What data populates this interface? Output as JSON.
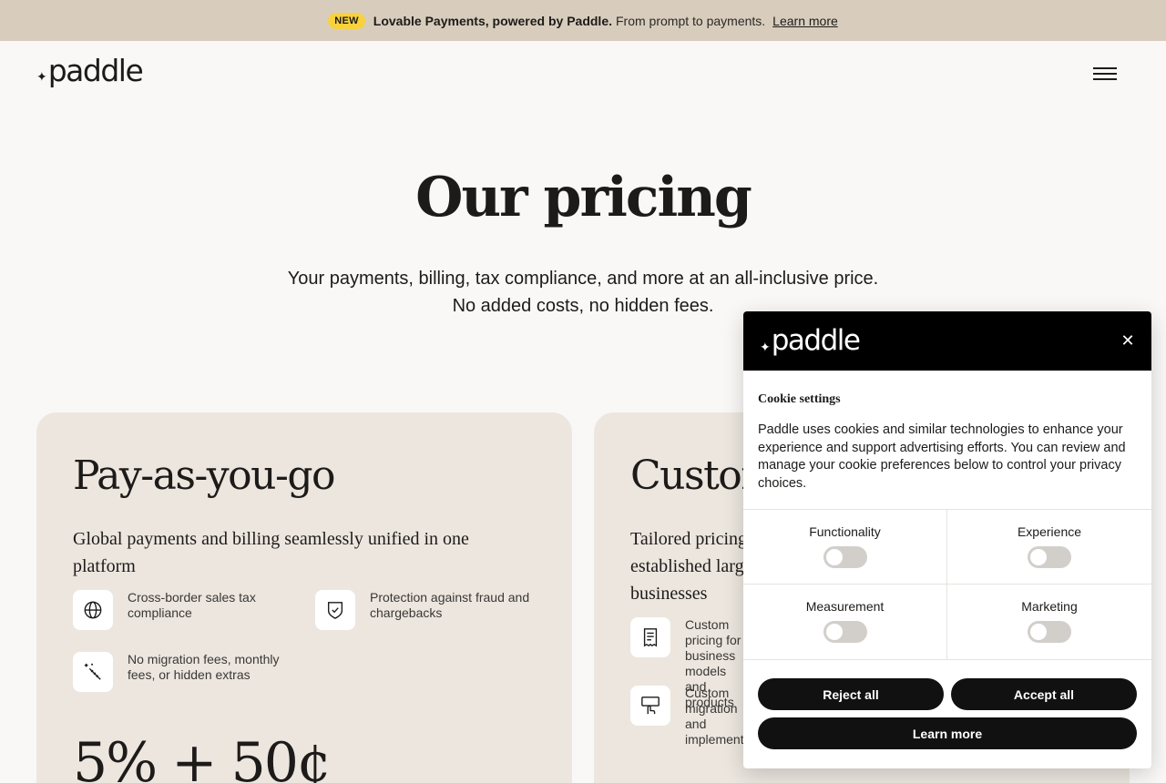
{
  "banner": {
    "badge": "NEW",
    "strong": "Lovable Payments, powered by Paddle.",
    "rest": "From prompt to payments.",
    "link": "Learn more"
  },
  "header": {
    "logo": "paddle",
    "menu_icon": "hamburger-menu-icon"
  },
  "hero": {
    "title": "Our pricing",
    "subtitle_line1": "Your payments, billing, tax compliance, and more at an all-inclusive price.",
    "subtitle_line2": "No added costs, no hidden fees."
  },
  "plans": [
    {
      "title": "Pay-as-you-go",
      "description": "Global payments and billing seamlessly unified in one platform",
      "features": [
        {
          "icon": "globe-icon",
          "text": "Cross-border sales tax compliance"
        },
        {
          "icon": "shield-check-icon",
          "text": "Protection against fraud and chargebacks"
        },
        {
          "icon": "magic-wand-icon",
          "text": "No migration fees, monthly fees, or hidden extras"
        }
      ],
      "price": "5% + 50¢"
    },
    {
      "title": "Custom",
      "description": "Tailored pricing for established large businesses",
      "features": [
        {
          "icon": "receipt-icon",
          "text": "Custom pricing for business models and products"
        },
        {
          "icon": "hand-pointer-icon",
          "text": "Custom migration and implementation"
        }
      ]
    }
  ],
  "cookie": {
    "logo": "paddle",
    "close_icon": "close-icon",
    "title": "Cookie settings",
    "body": "Paddle uses cookies and similar technologies to enhance your experience and support advertising efforts. You can review and manage your cookie preferences below to control your privacy choices.",
    "categories": [
      {
        "label": "Functionality",
        "enabled": false
      },
      {
        "label": "Experience",
        "enabled": false
      },
      {
        "label": "Measurement",
        "enabled": false
      },
      {
        "label": "Marketing",
        "enabled": false
      }
    ],
    "reject": "Reject all",
    "accept": "Accept all",
    "learn": "Learn more"
  },
  "colors": {
    "banner_bg": "#d8cdbd",
    "badge_bg": "#f7d23e",
    "page_bg": "#f9f8f6",
    "card_bg": "#ece6df",
    "button_bg": "#111111"
  }
}
